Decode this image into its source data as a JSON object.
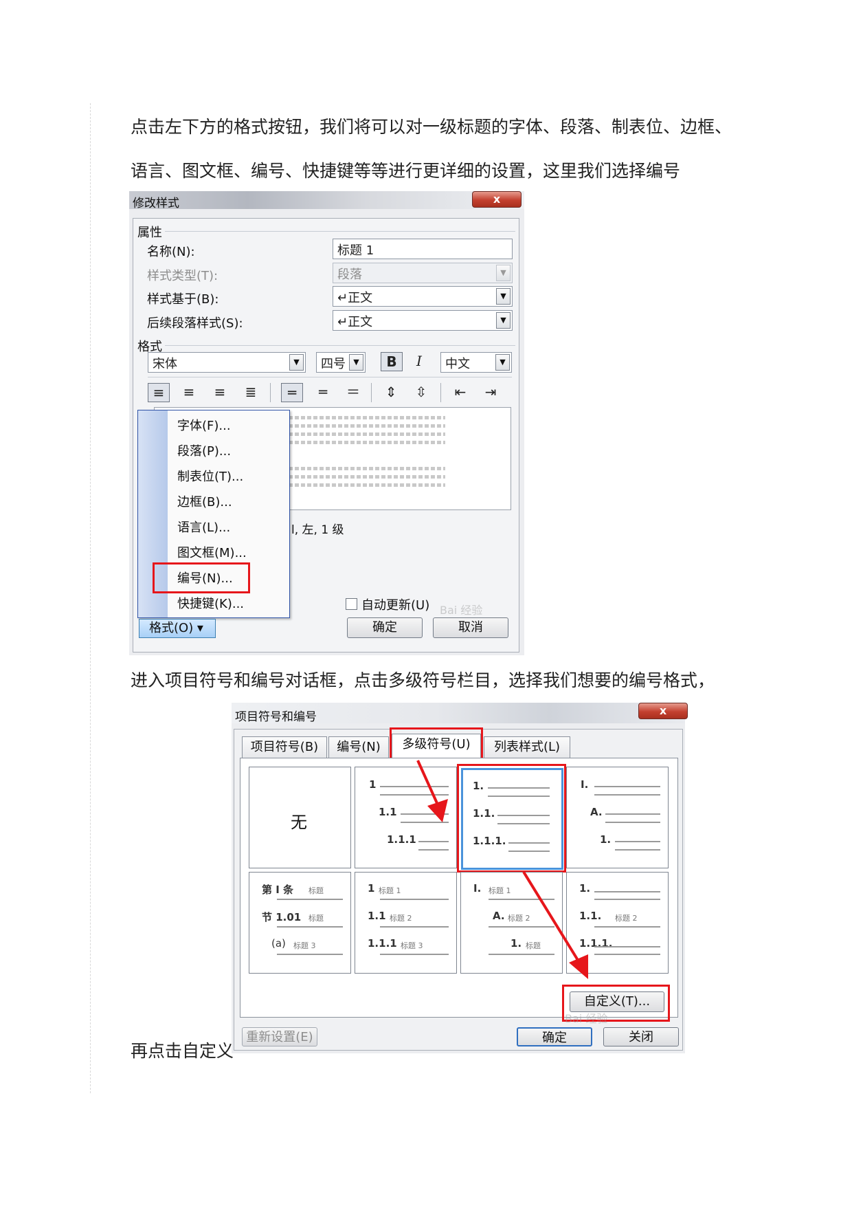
{
  "article": {
    "para1_line1": "点击左下方的格式按钮，我们将可以对一级标题的字体、段落、制表位、边框、",
    "para1_line2": "语言、图文框、编号、快捷键等等进行更详细的设置，这里我们选择编号",
    "para2": "进入项目符号和编号对话框，点击多级符号栏目，选择我们想要的编号格式，",
    "para3": "再点击自定义"
  },
  "dialog_modify_style": {
    "title": "修改样式",
    "close_label": "x",
    "properties_group": "属性",
    "name_label": "名称(N):",
    "name_value": "标题 1",
    "style_type_label": "样式类型(T):",
    "style_type_value": "段落",
    "based_on_label": "样式基于(B):",
    "based_on_value": "↵正文",
    "following_label": "后续段落样式(S):",
    "following_value": "↵正文",
    "format_group": "格式",
    "font_value": "宋体",
    "size_value": "四号",
    "bold_label": "B",
    "italic_label": "I",
    "script_value": "中文",
    "description_text": "l, 左, 1 级",
    "format_menu": [
      "字体(F)...",
      "段落(P)...",
      "制表位(T)...",
      "边框(B)...",
      "语言(L)...",
      "图文框(M)...",
      "编号(N)...",
      "快捷键(K)..."
    ],
    "format_button_label": "格式(O) ▾",
    "auto_update_label": "自动更新(U)",
    "ok_label": "确定",
    "cancel_label": "取消"
  },
  "dialog_bullets": {
    "title": "项目符号和编号",
    "close_label": "x",
    "tabs": [
      "项目符号(B)",
      "编号(N)",
      "多级符号(U)",
      "列表样式(L)"
    ],
    "active_tab": "多级符号(U)",
    "none_label": "无",
    "cell2": [
      "1",
      "1.1",
      "1.1.1"
    ],
    "cell3": [
      "1.",
      "1.1.",
      "1.1.1."
    ],
    "cell4": [
      "I.",
      "A.",
      "1."
    ],
    "cell5": [
      "第 Ⅰ 条",
      "节 1.01",
      "(a)"
    ],
    "cell5_headings": [
      "标题",
      "标题",
      "标题 3"
    ],
    "cell6": [
      "1",
      "1.1",
      "1.1.1"
    ],
    "cell6_headings": [
      "标题 1",
      "标题 2",
      "标题 3"
    ],
    "cell7": [
      "I.",
      "A.",
      "1."
    ],
    "cell7_headings": [
      "标题 1",
      "标题 2",
      "标题"
    ],
    "cell8": [
      "1.",
      "1.1.",
      "1.1.1."
    ],
    "cell8_headings": [
      "标题 2"
    ],
    "customize_label": "自定义(T)...",
    "reset_label": "重新设置(E)",
    "ok_label": "确定",
    "close_button_label": "关闭"
  },
  "colors": {
    "highlight_red": "#e6161b",
    "selection_blue": "#4a93db"
  },
  "watermark": "Bai 经验"
}
